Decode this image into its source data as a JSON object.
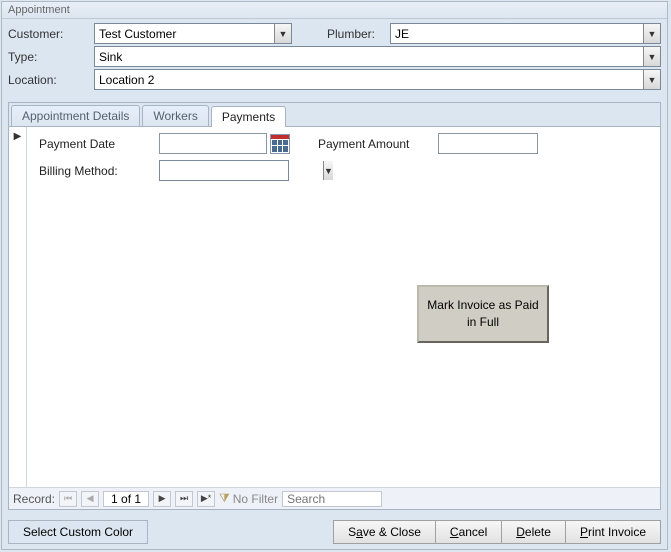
{
  "window": {
    "title": "Appointment"
  },
  "header": {
    "customer_label": "Customer:",
    "customer_value": "Test Customer",
    "plumber_label": "Plumber:",
    "plumber_value": "JE",
    "type_label": "Type:",
    "type_value": "Sink",
    "location_label": "Location:",
    "location_value": "Location 2"
  },
  "tabs": {
    "tab1": "Appointment Details",
    "tab2": "Workers",
    "tab3": "Payments"
  },
  "payments": {
    "payment_date_label": "Payment Date",
    "payment_date_value": "",
    "payment_amount_label": "Payment Amount",
    "payment_amount_value": "",
    "billing_method_label": "Billing Method:",
    "billing_method_value": "",
    "mark_paid_label": "Mark Invoice as Paid in Full"
  },
  "record_nav": {
    "label": "Record:",
    "position": "1 of 1",
    "filter": "No Filter",
    "search_placeholder": "Search"
  },
  "footer": {
    "custom_color": "Select Custom Color",
    "save_close_pre": "S",
    "save_close_u": "a",
    "save_close_post": "ve & Close",
    "cancel_u": "C",
    "cancel_post": "ancel",
    "delete_u": "D",
    "delete_post": "elete",
    "print_u": "P",
    "print_post": "rint Invoice"
  }
}
